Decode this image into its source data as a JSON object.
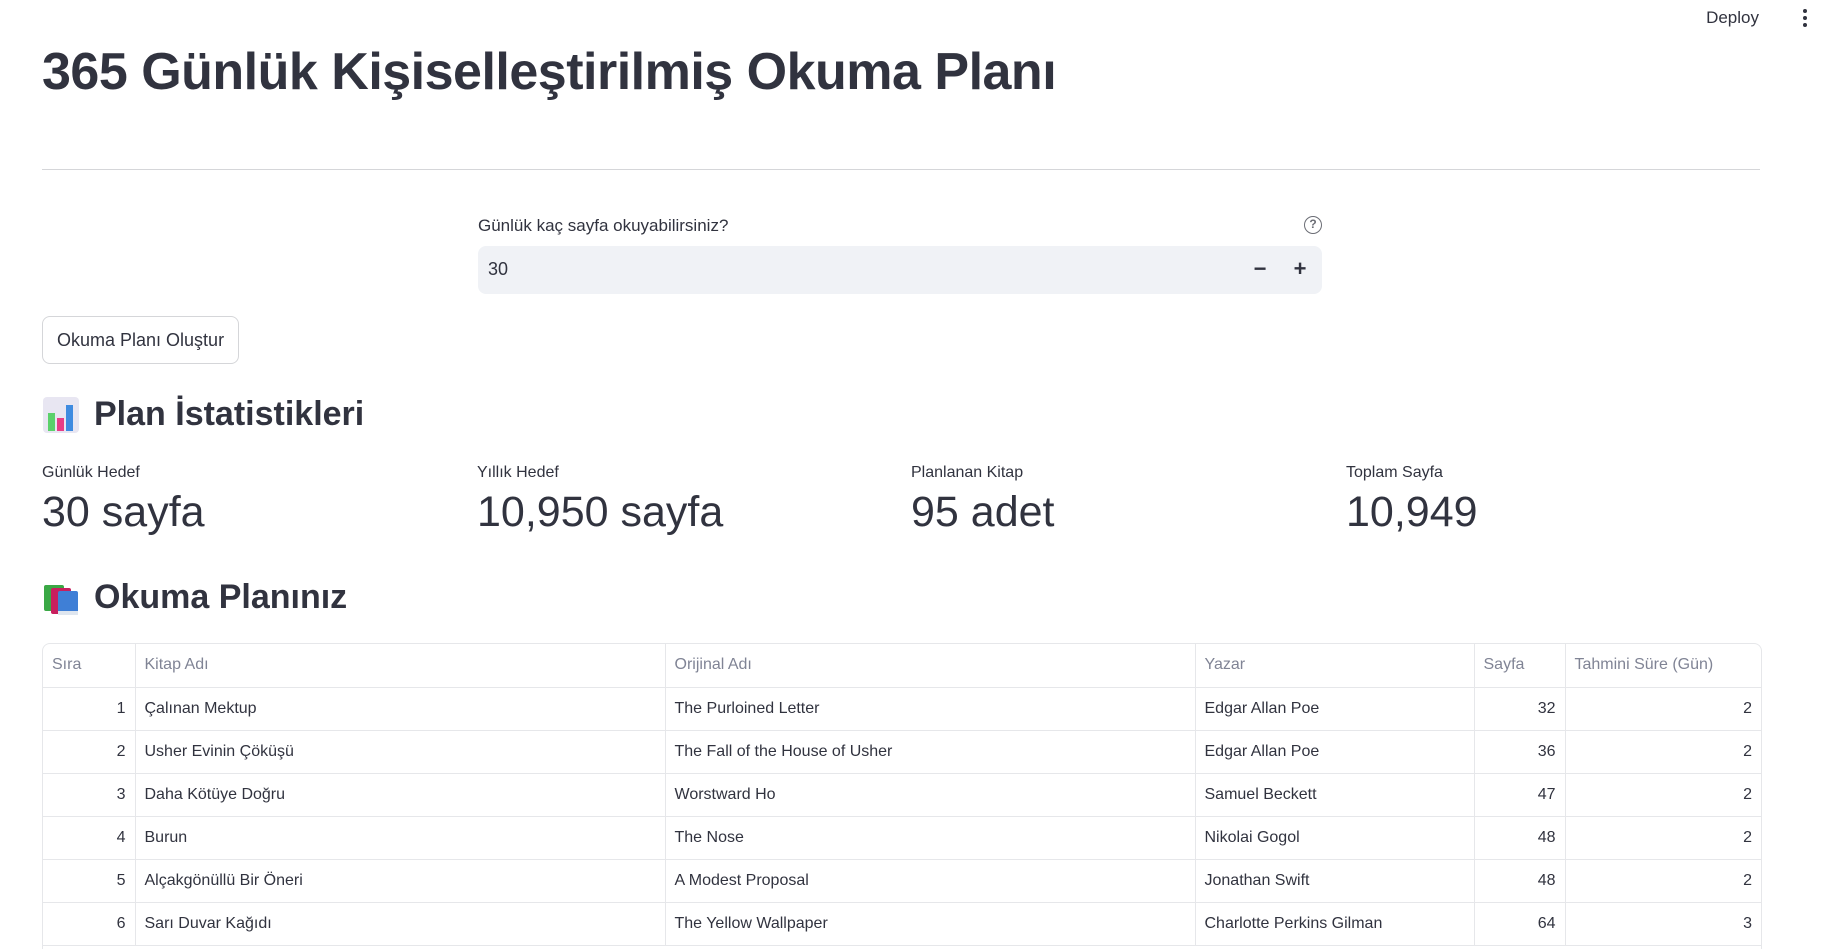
{
  "header": {
    "deploy_label": "Deploy",
    "menu_icon": "kebab-menu-icon"
  },
  "page": {
    "title": "365 Günlük Kişiselleştirilmiş Okuma Planı"
  },
  "daily_input": {
    "label": "Günlük kaç sayfa okuyabilirsiniz?",
    "value": "30",
    "help_icon": "help-circle-icon",
    "decrement_symbol": "−",
    "increment_symbol": "+"
  },
  "create_button": {
    "label": "Okuma Planı Oluştur"
  },
  "stats": {
    "heading": "Plan İstatistikleri",
    "icon": "bar-chart-icon",
    "metrics": [
      {
        "label": "Günlük Hedef",
        "value": "30 sayfa"
      },
      {
        "label": "Yıllık Hedef",
        "value": "10,950 sayfa"
      },
      {
        "label": "Planlanan Kitap",
        "value": "95 adet"
      },
      {
        "label": "Toplam Sayfa",
        "value": "10,949"
      }
    ]
  },
  "plan": {
    "heading": "Okuma Planınız",
    "icon": "books-icon",
    "columns": [
      "Sıra",
      "Kitap Adı",
      "Orijinal Adı",
      "Yazar",
      "Sayfa",
      "Tahmini Süre (Gün)"
    ],
    "rows": [
      [
        "1",
        "Çalınan Mektup",
        "The Purloined Letter",
        "Edgar Allan Poe",
        "32",
        "2"
      ],
      [
        "2",
        "Usher Evinin Çöküşü",
        "The Fall of the House of Usher",
        "Edgar Allan Poe",
        "36",
        "2"
      ],
      [
        "3",
        "Daha Kötüye Doğru",
        "Worstward Ho",
        "Samuel Beckett",
        "47",
        "2"
      ],
      [
        "4",
        "Burun",
        "The Nose",
        "Nikolai Gogol",
        "48",
        "2"
      ],
      [
        "5",
        "Alçakgönüllü Bir Öneri",
        "A Modest Proposal",
        "Jonathan Swift",
        "48",
        "2"
      ],
      [
        "6",
        "Sarı Duvar Kağıdı",
        "The Yellow Wallpaper",
        "Charlotte Perkins Gilman",
        "64",
        "3"
      ]
    ]
  }
}
